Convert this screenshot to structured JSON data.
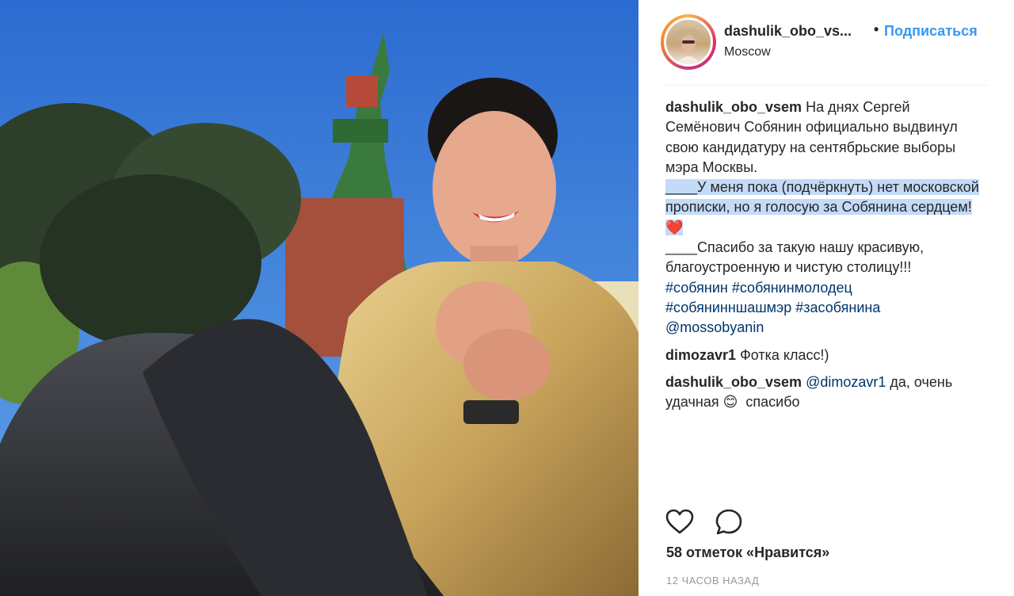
{
  "post": {
    "username": "dashulik_obo_vsem",
    "username_truncated": "dashulik_obo_vs...",
    "separator": "•",
    "follow_label": "Подписаться",
    "location": "Moscow"
  },
  "caption": {
    "author": "dashulik_obo_vsem",
    "line1": "На днях Сергей Семёнович Собянин официально выдвинул свою кандидатуру на сентябрьские выборы мэра Москвы.",
    "line2": "____У меня пока (подчёркнуть) нет московской прописки, но я голосую за Собянина сердцем!",
    "heart_emoji": "❤️",
    "line3": "____Спасибо за такую нашу красивую, благоустроенную и чистую столицу!!!",
    "hashtags": [
      "#собянин",
      "#собянинмолодец",
      "#собянинншашмэр",
      "#засобянина"
    ],
    "mention": "@mossobyanin"
  },
  "comments": [
    {
      "author": "dimozavr1",
      "text": "Фотка класс!)"
    },
    {
      "author": "dashulik_obo_vsem",
      "mention": "@dimozavr1",
      "text": " да, очень удачная ",
      "emoji": "😊",
      "text2": "  спасибо"
    }
  ],
  "actions": {
    "like_icon": "heart-outline-icon",
    "comment_icon": "speech-bubble-icon"
  },
  "likes_label": "58 отметок «Нравится»",
  "timestamp": "12 часов назад",
  "colors": {
    "link": "#3897f0",
    "hashtag": "#003569",
    "highlight": "#c3dbf7"
  }
}
